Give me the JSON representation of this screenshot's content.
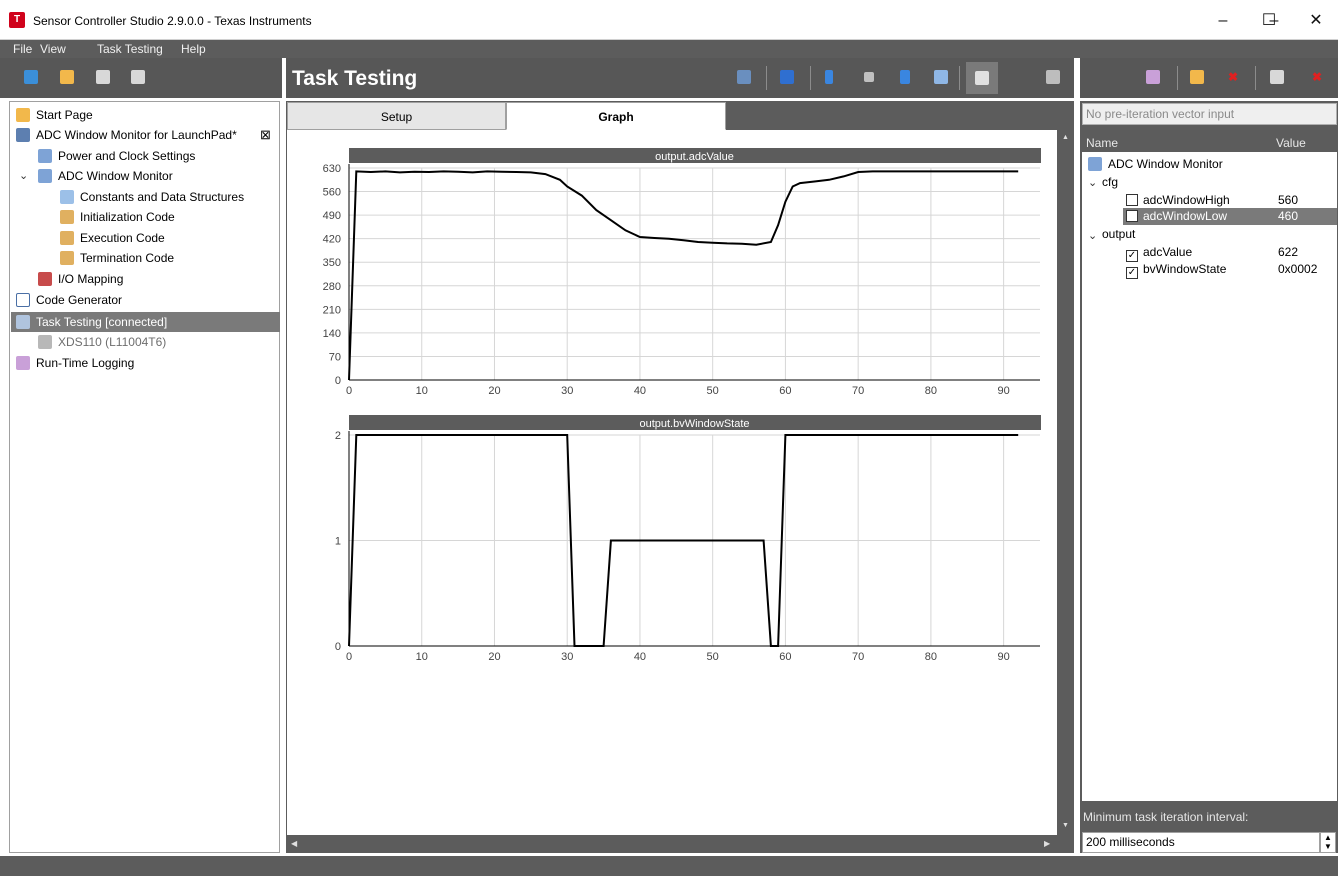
{
  "window": {
    "title": "Sensor Controller Studio 2.9.0.0 - Texas Instruments",
    "minimize": "–",
    "maximize": "☐",
    "close": "✕"
  },
  "menu": {
    "file": "File",
    "view": "View",
    "task_testing": "Task Testing",
    "help": "Help"
  },
  "header": {
    "title": "Task Testing"
  },
  "project_tree": {
    "start_page": "Start Page",
    "project": "ADC Window Monitor for LaunchPad*",
    "close_glyph": "⊠",
    "power_clock": "Power and Clock Settings",
    "task": "ADC Window Monitor",
    "constants": "Constants and Data Structures",
    "init_code": "Initialization Code",
    "exec_code": "Execution Code",
    "term_code": "Termination Code",
    "io_mapping": "I/O Mapping",
    "code_gen": "Code Generator",
    "task_testing": "Task Testing [connected]",
    "debugger": "XDS110 (L11004T6)",
    "runtime_logging": "Run-Time Logging"
  },
  "tabs": {
    "setup": "Setup",
    "graph": "Graph",
    "active": "Graph"
  },
  "chart_data": [
    {
      "type": "line",
      "title": "output.adcValue",
      "xlim": [
        0,
        95
      ],
      "ylim": [
        0,
        630
      ],
      "xticks": [
        "0",
        "10",
        "20",
        "30",
        "40",
        "50",
        "60",
        "70",
        "80",
        "90"
      ],
      "yticks": [
        "0",
        "70",
        "140",
        "210",
        "280",
        "350",
        "420",
        "490",
        "560",
        "630"
      ],
      "x": [
        0,
        1,
        3,
        5,
        7,
        9,
        11,
        13,
        15,
        17,
        19,
        21,
        23,
        25,
        27,
        29,
        30,
        32,
        34,
        36,
        38,
        40,
        42,
        44,
        46,
        48,
        50,
        52,
        54,
        56,
        58,
        59,
        60,
        61,
        62,
        64,
        66,
        68,
        70,
        72,
        74,
        76,
        78,
        80,
        82,
        84,
        86,
        88,
        90,
        92
      ],
      "y": [
        0,
        620,
        618,
        620,
        617,
        619,
        618,
        620,
        619,
        617,
        620,
        619,
        618,
        617,
        612,
        595,
        575,
        548,
        505,
        475,
        445,
        425,
        422,
        420,
        415,
        410,
        408,
        406,
        405,
        402,
        410,
        460,
        530,
        575,
        585,
        590,
        595,
        605,
        618,
        620,
        620,
        620,
        620,
        620,
        620,
        620,
        620,
        620,
        620,
        620
      ]
    },
    {
      "type": "line",
      "title": "output.bvWindowState",
      "xlim": [
        0,
        95
      ],
      "ylim": [
        0,
        2
      ],
      "xticks": [
        "0",
        "10",
        "20",
        "30",
        "40",
        "50",
        "60",
        "70",
        "80",
        "90"
      ],
      "yticks": [
        "0",
        "1",
        "2"
      ],
      "x": [
        0,
        1,
        29,
        30,
        31,
        35,
        36,
        57,
        58,
        59,
        60,
        92
      ],
      "y": [
        0,
        2,
        2,
        2,
        0,
        0,
        1,
        1,
        0,
        0,
        2,
        2
      ]
    }
  ],
  "vars_panel": {
    "pre_iteration_placeholder": "No pre-iteration vector input",
    "col_name": "Name",
    "col_value": "Value",
    "root": "ADC Window Monitor",
    "cfg_group": "cfg",
    "cfg": [
      {
        "name": "adcWindowHigh",
        "value": "560",
        "checked": false
      },
      {
        "name": "adcWindowLow",
        "value": "460",
        "checked": false
      }
    ],
    "output_group": "output",
    "output": [
      {
        "name": "adcValue",
        "value": "622",
        "checked": true
      },
      {
        "name": "bvWindowState",
        "value": "0x0002",
        "checked": true
      }
    ],
    "min_interval_label": "Minimum task iteration interval:",
    "min_interval_value": "200 milliseconds"
  },
  "colors": {
    "panel_bg": "#5c5c5c",
    "selected_row": "#7a7a7a",
    "toolbar_bg": "#575757",
    "plot_line": "#000000",
    "app_icon": "#d0021b"
  }
}
